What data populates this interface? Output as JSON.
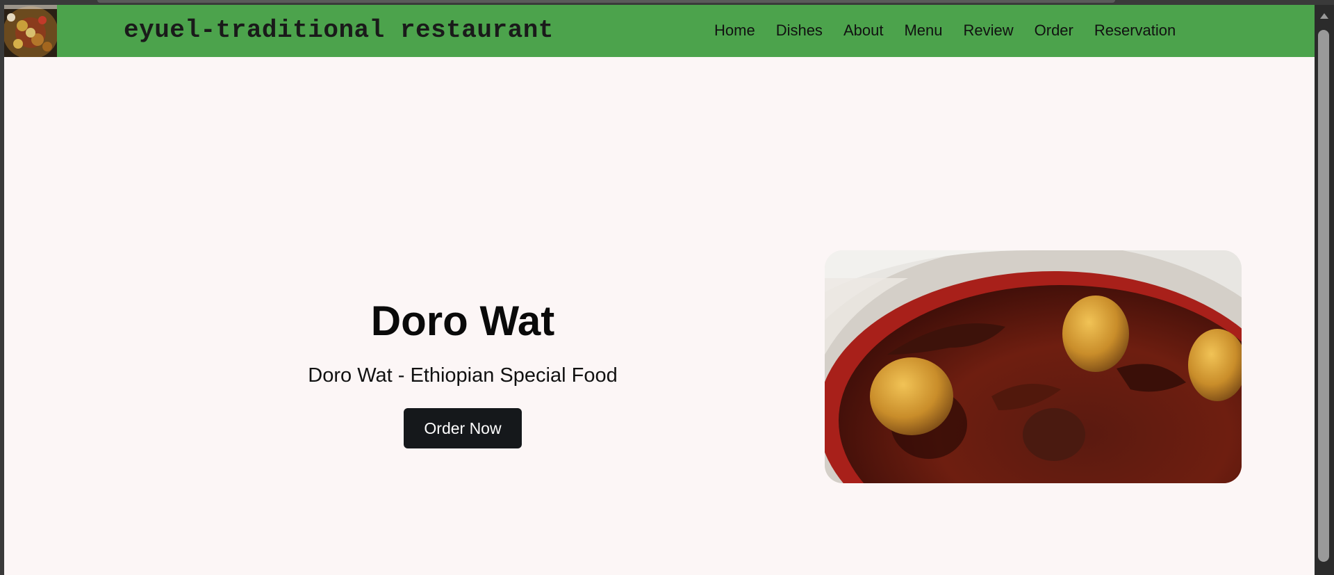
{
  "site": {
    "brand": "eyuel-traditional restaurant",
    "logo_icon": "food-platter-logo"
  },
  "nav": {
    "items": [
      {
        "label": "Home"
      },
      {
        "label": "Dishes"
      },
      {
        "label": "About"
      },
      {
        "label": "Menu"
      },
      {
        "label": "Review"
      },
      {
        "label": "Order"
      },
      {
        "label": "Reservation"
      }
    ]
  },
  "hero": {
    "title": "Doro Wat",
    "subtitle": "Doro Wat - Ethiopian Special Food",
    "button_label": "Order Now",
    "image_icon": "doro-wat-dish-image"
  },
  "colors": {
    "navbar": "#4ca34c",
    "page_background": "#fcf6f6",
    "button": "#15181b",
    "button_text": "#ffffff"
  }
}
